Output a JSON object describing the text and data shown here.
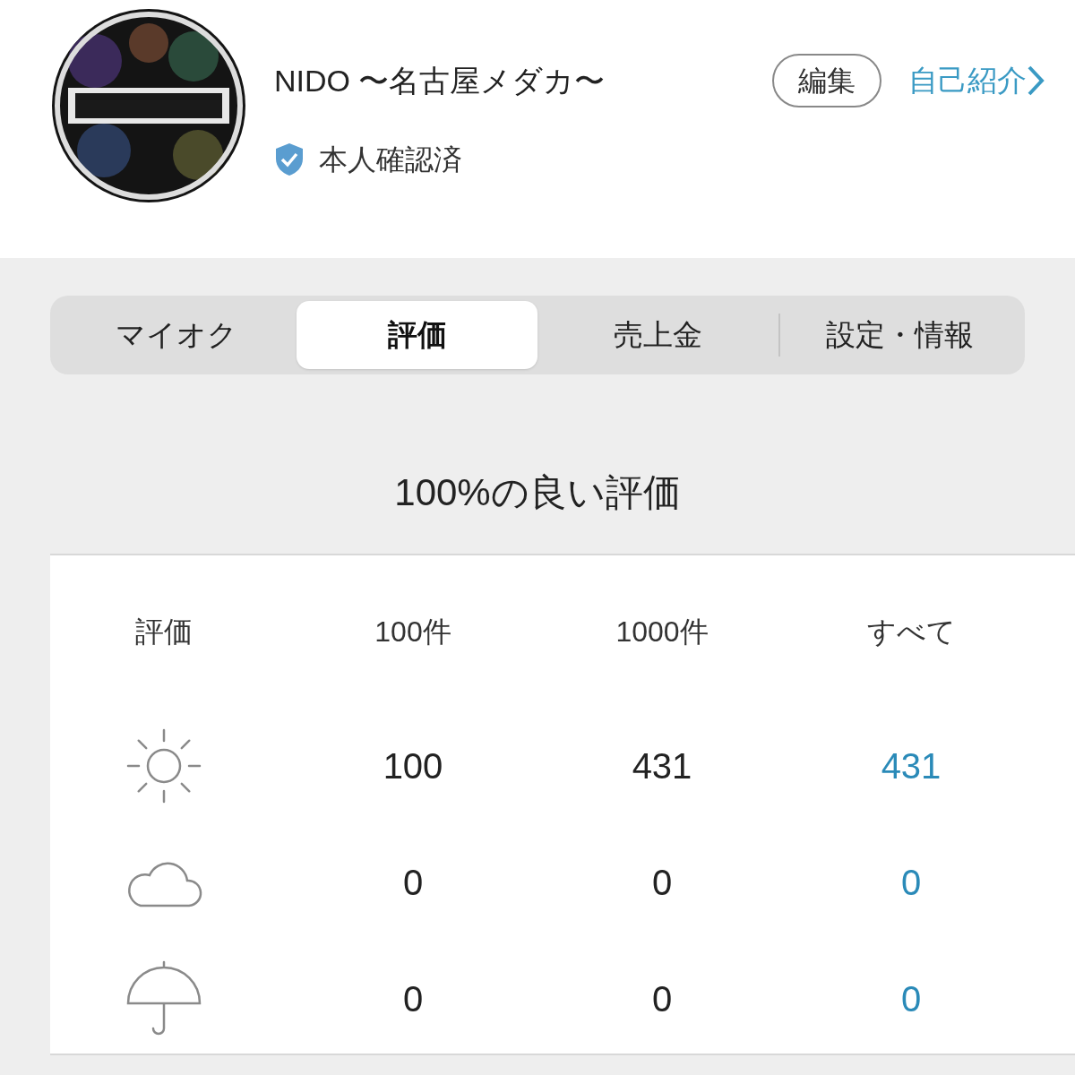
{
  "profile": {
    "name": "NIDO 〜名古屋メダカ〜",
    "verified": true,
    "verified_label": "本人確認済",
    "edit_button": "編集",
    "intro_link": "自己紹介"
  },
  "tabs": [
    {
      "label": "マイオク",
      "selected": false
    },
    {
      "label": "評価",
      "selected": true
    },
    {
      "label": "売上金",
      "selected": false
    },
    {
      "label": "設定・情報",
      "selected": false
    }
  ],
  "summary": "100%の良い評価",
  "table": {
    "icon_column": "評価",
    "columns": [
      "100件",
      "1000件",
      "すべて"
    ],
    "rows": [
      {
        "kind": "sun",
        "cells": [
          "100",
          "431",
          "431"
        ]
      },
      {
        "kind": "cloud",
        "cells": [
          "0",
          "0",
          "0"
        ]
      },
      {
        "kind": "umbrella",
        "cells": [
          "0",
          "0",
          "0"
        ]
      }
    ]
  }
}
